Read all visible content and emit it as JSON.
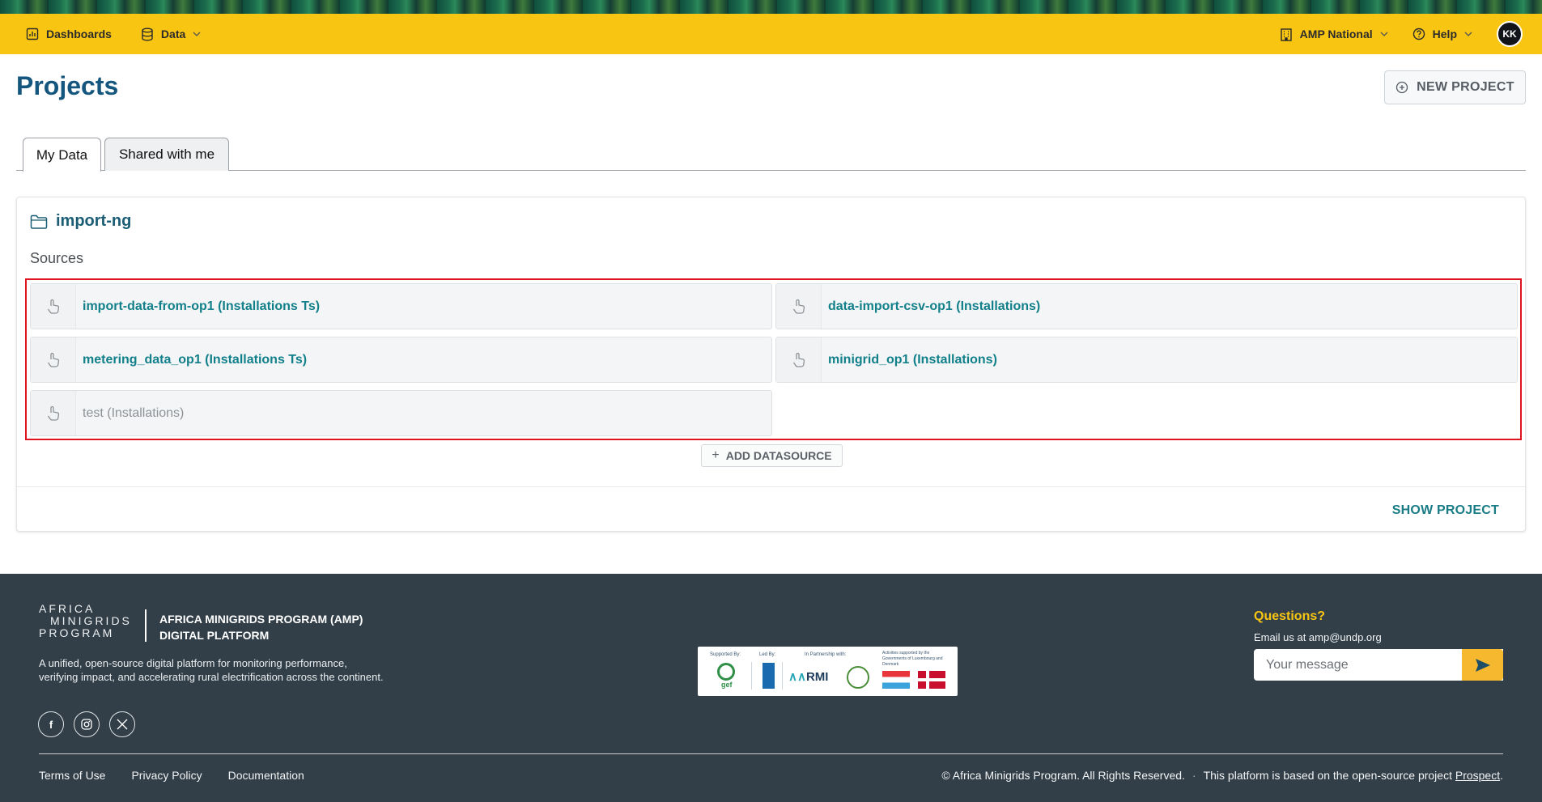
{
  "nav": {
    "dashboards": "Dashboards",
    "data": "Data",
    "org": "AMP National",
    "help": "Help",
    "avatar": "KK"
  },
  "page": {
    "title": "Projects",
    "new_project": "NEW PROJECT"
  },
  "tabs": [
    {
      "label": "My Data",
      "active": true
    },
    {
      "label": "Shared with me",
      "active": false
    }
  ],
  "project": {
    "name": "import-ng",
    "sources_label": "Sources",
    "sources": [
      {
        "label": "import-data-from-op1 (Installations Ts)",
        "active": true
      },
      {
        "label": "data-import-csv-op1 (Installations)",
        "active": true
      },
      {
        "label": "metering_data_op1 (Installations Ts)",
        "active": true
      },
      {
        "label": "minigrid_op1 (Installations)",
        "active": true
      },
      {
        "label": "test (Installations)",
        "active": false
      }
    ],
    "add_datasource": "ADD DATASOURCE",
    "show_project": "SHOW PROJECT"
  },
  "footer": {
    "logo_lines": [
      "AFRICA",
      "MINIGRIDS",
      "PROGRAM"
    ],
    "title_line1": "AFRICA MINIGRIDS PROGRAM (AMP)",
    "title_line2": "DIGITAL PLATFORM",
    "description": "A unified, open-source digital platform for monitoring performance, verifying impact, and accelerating rural electrification across the continent.",
    "socials": [
      "facebook-icon",
      "instagram-icon",
      "x-icon"
    ],
    "partners": {
      "supported_by": "Supported By:",
      "led_by": "Led By:",
      "in_partnership": "In Partnership with:",
      "activities": "Activities supported by the Governments of Luxembourg and Denmark",
      "gef": "gef",
      "amrmi": "RMI"
    },
    "questions_title": "Questions?",
    "questions_email": "Email us at amp@undp.org",
    "message_placeholder": "Your message",
    "links": [
      "Terms of Use",
      "Privacy Policy",
      "Documentation"
    ],
    "copyright": "© Africa Minigrids Program. All Rights Reserved.",
    "based_on": "This platform is based on the open-source project",
    "prospect": "Prospect",
    "period": "."
  },
  "colors": {
    "nav_bg": "#f9c513",
    "title": "#14567d",
    "source_link": "#11808a",
    "highlight": "#e0141e",
    "footer_bg": "#323f48"
  }
}
